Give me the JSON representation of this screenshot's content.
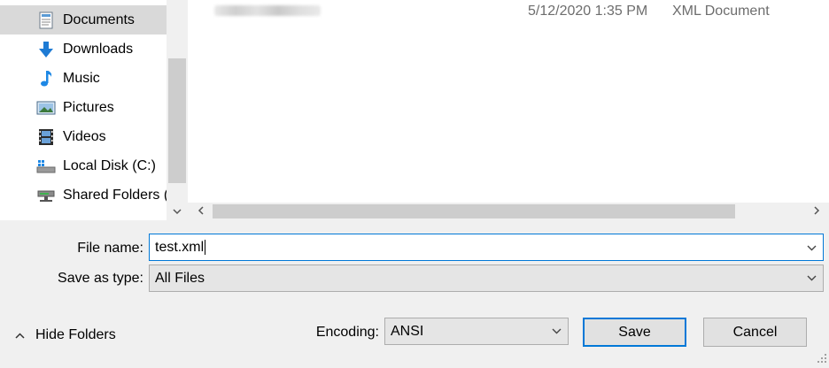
{
  "nav": {
    "items": [
      {
        "label": "Documents",
        "icon": "documents-icon",
        "selected": true
      },
      {
        "label": "Downloads",
        "icon": "downloads-icon",
        "selected": false
      },
      {
        "label": "Music",
        "icon": "music-icon",
        "selected": false
      },
      {
        "label": "Pictures",
        "icon": "pictures-icon",
        "selected": false
      },
      {
        "label": "Videos",
        "icon": "videos-icon",
        "selected": false
      },
      {
        "label": "Local Disk (C:)",
        "icon": "local-disk-icon",
        "selected": false
      },
      {
        "label": "Shared Folders (\\",
        "icon": "shared-folders-icon",
        "selected": false
      }
    ]
  },
  "files": [
    {
      "name_blurred": true,
      "date": "5/12/2020 1:35 PM",
      "type": "XML Document"
    }
  ],
  "form": {
    "file_name_label": "File name:",
    "file_name_value": "test.xml",
    "save_type_label": "Save as type:",
    "save_type_value": "All Files",
    "encoding_label": "Encoding:",
    "encoding_value": "ANSI"
  },
  "buttons": {
    "hide_folders": "Hide Folders",
    "save": "Save",
    "cancel": "Cancel"
  },
  "colors": {
    "accent": "#0078d7",
    "selected_bg": "#d9d9d9",
    "dialog_bg": "#f0f0f0"
  }
}
